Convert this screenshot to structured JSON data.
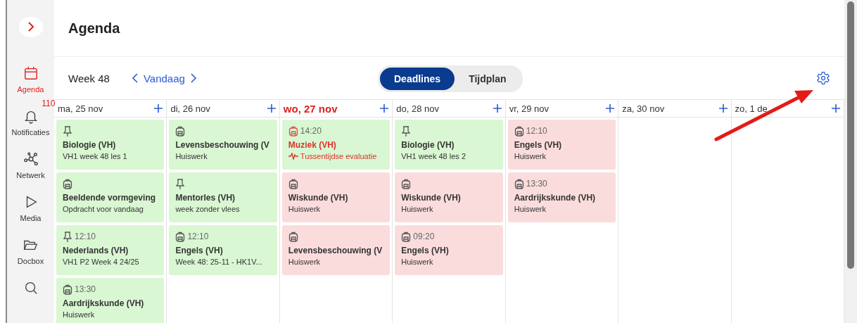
{
  "sidebar": {
    "items": [
      {
        "label": "Agenda",
        "selected": true
      },
      {
        "label": "Notificaties",
        "badge": "110",
        "selected": false
      },
      {
        "label": "Netwerk",
        "selected": false
      },
      {
        "label": "Media",
        "selected": false
      },
      {
        "label": "Docbox",
        "selected": false
      },
      {
        "selected": false
      }
    ]
  },
  "header": {
    "title": "Agenda"
  },
  "toolbar": {
    "week": "Week 48",
    "today": "Vandaag",
    "views": [
      {
        "label": "Deadlines",
        "selected": true
      },
      {
        "label": "Tijdplan",
        "selected": false
      }
    ]
  },
  "days": [
    {
      "label": "ma, 25 nov",
      "today": false,
      "cards": [
        {
          "kind": "pin",
          "color": "#d9f7d2",
          "title": "Biologie (VH)",
          "subtitle": "VH1 week 48 les 1",
          "alert": false
        },
        {
          "kind": "bag",
          "color": "#d9f7d2",
          "title": "Beeldende vormgeving",
          "subtitle": "Opdracht voor vandaag",
          "alert": false
        },
        {
          "kind": "pin",
          "time": "12:10",
          "color": "#d9f7d2",
          "title": "Nederlands (VH)",
          "subtitle": "VH1 P2 Week 4 24/25",
          "alert": false
        },
        {
          "kind": "bag",
          "time": "13:30",
          "color": "#d9f7d2",
          "title": "Aardrijkskunde (VH)",
          "subtitle": "Huiswerk",
          "alert": false
        }
      ]
    },
    {
      "label": "di, 26 nov",
      "today": false,
      "cards": [
        {
          "kind": "bag",
          "color": "#d9f7d2",
          "title": "Levensbeschouwing (V",
          "subtitle": "Huiswerk",
          "alert": false
        },
        {
          "kind": "pin",
          "color": "#d9f7d2",
          "title": "Mentorles (VH)",
          "subtitle": "week zonder vlees",
          "alert": false
        },
        {
          "kind": "bag",
          "time": "12:10",
          "color": "#d9f7d2",
          "title": "Engels (VH)",
          "subtitle": "Week 48: 25-11 - HK1V...",
          "alert": false
        }
      ]
    },
    {
      "label": "wo, 27 nov",
      "today": true,
      "cards": [
        {
          "kind": "bag",
          "time": "14:20",
          "color": "#d9f7d2",
          "title": "Muziek (VH)",
          "subtitle": "Tussentijdse evaluatie",
          "alert": true
        },
        {
          "kind": "bag",
          "color": "#fbdcdc",
          "title": "Wiskunde (VH)",
          "subtitle": "Huiswerk",
          "alert": false
        },
        {
          "kind": "bag",
          "color": "#fbdcdc",
          "title": "Levensbeschouwing (V",
          "subtitle": "Huiswerk",
          "alert": false
        }
      ]
    },
    {
      "label": "do, 28 nov",
      "today": false,
      "cards": [
        {
          "kind": "pin",
          "color": "#d9f7d2",
          "title": "Biologie (VH)",
          "subtitle": "VH1 week 48 les 2",
          "alert": false
        },
        {
          "kind": "bag",
          "color": "#fbdcdc",
          "title": "Wiskunde (VH)",
          "subtitle": "Huiswerk",
          "alert": false
        },
        {
          "kind": "bag",
          "time": "09:20",
          "color": "#fbdcdc",
          "title": "Engels (VH)",
          "subtitle": "Huiswerk",
          "alert": false
        }
      ]
    },
    {
      "label": "vr, 29 nov",
      "today": false,
      "cards": [
        {
          "kind": "bag",
          "time": "12:10",
          "color": "#fbdcdc",
          "title": "Engels (VH)",
          "subtitle": "Huiswerk",
          "alert": false
        },
        {
          "kind": "bag",
          "time": "13:30",
          "color": "#fbdcdc",
          "title": "Aardrijkskunde (VH)",
          "subtitle": "Huiswerk",
          "alert": false
        }
      ]
    },
    {
      "label": "za, 30 nov",
      "today": false
    },
    {
      "label": "zo, 1 de",
      "today": false
    }
  ]
}
